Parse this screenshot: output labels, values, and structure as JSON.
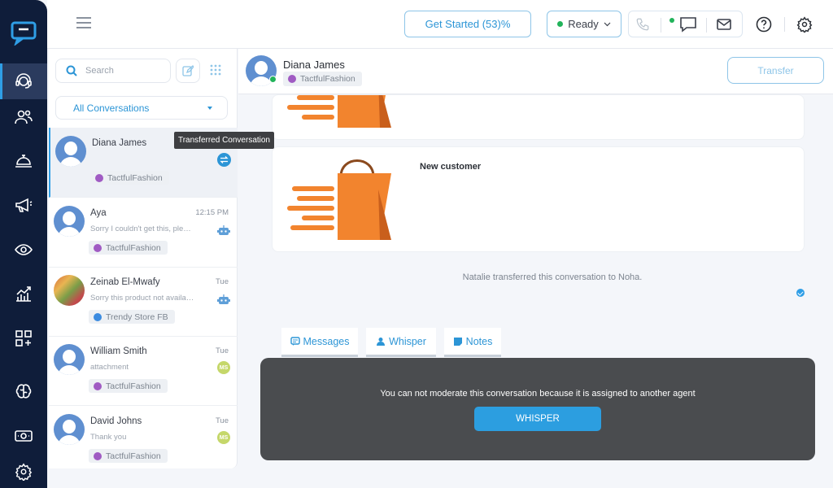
{
  "rail": {
    "items": [
      {
        "name": "agent-headset",
        "icon": "headset-icon",
        "active": true
      },
      {
        "name": "contacts",
        "icon": "users-icon"
      },
      {
        "name": "service-bell",
        "icon": "bell-icon"
      },
      {
        "name": "campaigns",
        "icon": "megaphone-icon"
      },
      {
        "name": "monitor",
        "icon": "eye-icon"
      },
      {
        "name": "analytics",
        "icon": "chart-icon"
      },
      {
        "name": "apps",
        "icon": "grid-plus-icon"
      },
      {
        "name": "ai-brain",
        "icon": "brain-icon"
      },
      {
        "name": "billing",
        "icon": "cash-icon"
      },
      {
        "name": "settings",
        "icon": "gear-icon"
      }
    ]
  },
  "topbar": {
    "get_started": "Get Started (53)%",
    "status": "Ready",
    "status_color": "#21b35a"
  },
  "list": {
    "search_placeholder": "Search",
    "filter": "All Conversations",
    "tooltip": "Transferred Conversation",
    "conversations": [
      {
        "name": "Diana James",
        "time": "",
        "preview": "",
        "tag": "TactfulFashion",
        "channel": "brand"
      },
      {
        "name": "Aya",
        "time": "12:15 PM",
        "preview": "Sorry I couldn't get this, please try again",
        "tag": "TactfulFashion",
        "channel": "brand"
      },
      {
        "name": "Zeinab El-Mwafy",
        "time": "Tue",
        "preview": "Sorry this product not available",
        "tag": "Trendy Store FB",
        "channel": "facebook"
      },
      {
        "name": "William Smith",
        "time": "Tue",
        "preview": "attachment",
        "tag": "TactfulFashion",
        "channel": "brand",
        "badge": "MS"
      },
      {
        "name": "David Johns",
        "time": "Tue",
        "preview": "Thank you",
        "tag": "TactfulFashion",
        "channel": "brand",
        "badge": "MS"
      }
    ]
  },
  "chat": {
    "name": "Diana James",
    "tag": "TactfulFashion",
    "transfer": "Transfer",
    "card_caption": "New customer",
    "system_message": "Natalie transferred this conversation to Noha.",
    "tabs": [
      "Messages",
      "Whisper",
      "Notes"
    ],
    "moderation_text": "You can not moderate this conversation because it is assigned to another agent",
    "whisper_button": "WHISPER",
    "accent": "#2c9ee0",
    "bag_color": "#f2842e"
  }
}
